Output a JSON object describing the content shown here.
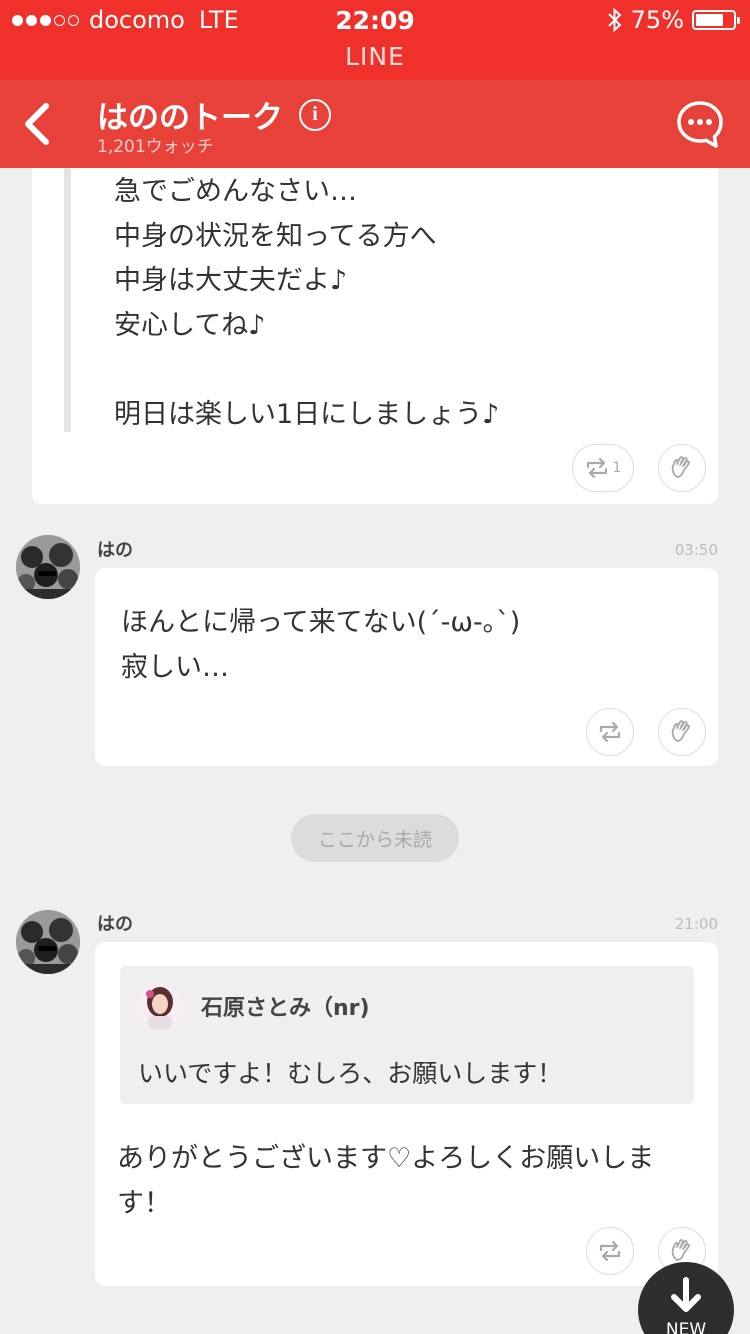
{
  "status_bar": {
    "carrier": "docomo",
    "network": "LTE",
    "time": "22:09",
    "battery": "75%",
    "battery_level": 0.75,
    "app_name": "LINE"
  },
  "header": {
    "title": "はののトーク",
    "subtitle": "1,201ウォッチ"
  },
  "quoted_post": {
    "text": "急でごめんなさい…\n中身の状況を知ってる方へ\n中身は大丈夫だよ♪\n安心してね♪\n\n明日は楽しい1日にしましょう♪",
    "repost_count": "1"
  },
  "messages": [
    {
      "user": "はの",
      "time": "03:50",
      "text": "ほんとに帰って来てない(´-ω-｡`)\n寂しい…"
    },
    {
      "user": "はの",
      "time": "21:00",
      "quote": {
        "name": "石原さとみ（nr)",
        "text": "いいですよ！むしろ、お願いします！"
      },
      "text": "ありがとうございます♡よろしくお願いします！"
    }
  ],
  "unread_divider": "ここから未読",
  "new_button": "NEW",
  "colors": {
    "status_bar": "#f0302a",
    "header": "#e8413a",
    "background": "#efefef"
  },
  "icons": [
    "back-arrow-icon",
    "info-icon",
    "chat-bubble-icon",
    "repost-icon",
    "clap-hand-icon",
    "bluetooth-icon",
    "battery-icon",
    "down-arrow-icon"
  ]
}
